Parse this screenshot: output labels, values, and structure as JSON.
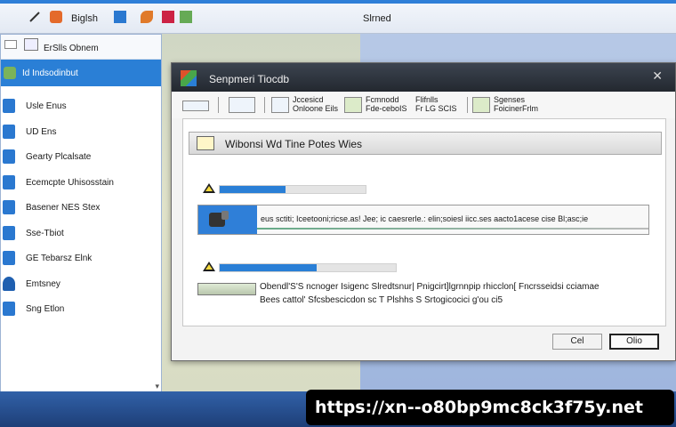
{
  "taskbar": {
    "app_label": "Biglsh",
    "right_label": "Slrned"
  },
  "sidebar": {
    "header": "ErSlls Obnem",
    "selected": "Id Indsodinbut",
    "items": [
      {
        "label": "Usle Enus",
        "icon": "document-icon"
      },
      {
        "label": "UD Ens",
        "icon": "document-icon"
      },
      {
        "label": "Gearty Plcalsate",
        "icon": "folder-icon"
      },
      {
        "label": "Ecemcpte Uhisosstain",
        "icon": "folder-icon"
      },
      {
        "label": "Basener NES Stex",
        "icon": "list-icon"
      },
      {
        "label": "Sse-Tbiot",
        "icon": "list-icon"
      },
      {
        "label": "GE Tebarsz Elnk",
        "icon": "document-icon"
      },
      {
        "label": "Emtsney",
        "icon": "network-icon"
      },
      {
        "label": "Sng Etlon",
        "icon": "document-icon"
      }
    ]
  },
  "dialog": {
    "title": "Senpmeri Tiocdb",
    "toolbar": [
      {
        "label": ""
      },
      {
        "label": ""
      },
      {
        "label": "Jccesicd\nOnloone Eils"
      },
      {
        "label": "Fcmnodd\nFde-ceboIS"
      },
      {
        "label": "Flifnlls\nFr LG SCIS"
      },
      {
        "label": "Sgenses\nFoicinerFrlm"
      }
    ],
    "header": "Wibonsi Wd Tine Potes Wies",
    "progress1": 0.45,
    "progress2": 0.55,
    "file_row_text": "eus sctiti; Iceetooni;ricse.as! Jee; ic caesrerle.: elin;soiesl iicc.ses aacto1acese cise Bl;asc;ie",
    "details_line1": "Obendl'S'S ncnoger Isigenc Slredtsnur| Pnigcirt]lgrnnpip rhicclon[ Fncrsseidsi cciamae",
    "details_line2": "Bees cattol' Sfcsbescicdon sc T Plshhs S Srtogicocici g'ou ci5",
    "buttons": {
      "cancel": "Cel",
      "ok": "Olio"
    }
  },
  "watermark": "https://xn--o80bp9mc8ck3f75y.net"
}
